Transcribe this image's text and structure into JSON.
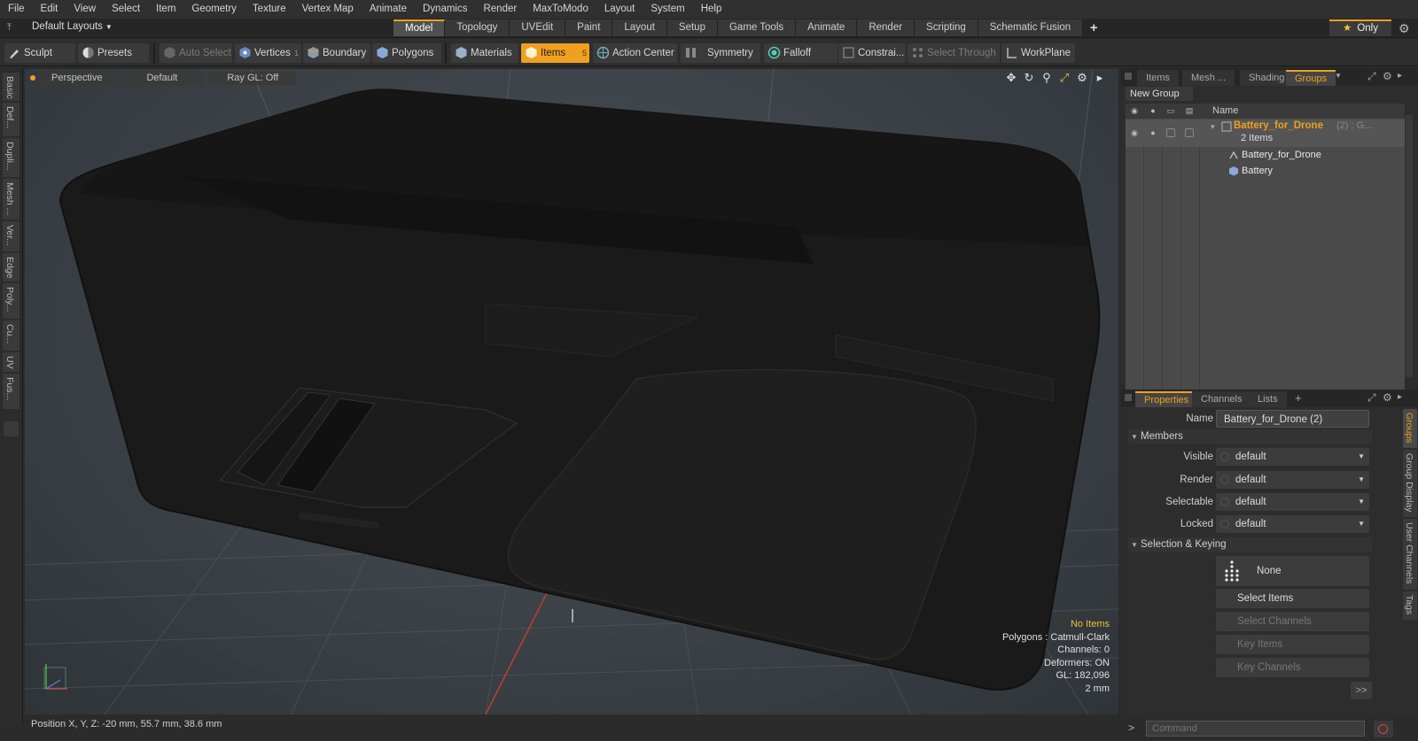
{
  "menu": [
    "File",
    "Edit",
    "View",
    "Select",
    "Item",
    "Geometry",
    "Texture",
    "Vertex Map",
    "Animate",
    "Dynamics",
    "Render",
    "MaxToModo",
    "Layout",
    "System",
    "Help"
  ],
  "layout_select": "Default Layouts",
  "tabs": [
    {
      "label": "Model",
      "active": true
    },
    {
      "label": "Topology",
      "active": false
    },
    {
      "label": "UVEdit",
      "active": false
    },
    {
      "label": "Paint",
      "active": false
    },
    {
      "label": "Layout",
      "active": false
    },
    {
      "label": "Setup",
      "active": false
    },
    {
      "label": "Game Tools",
      "active": false
    },
    {
      "label": "Animate",
      "active": false
    },
    {
      "label": "Render",
      "active": false
    },
    {
      "label": "Scripting",
      "active": false
    },
    {
      "label": "Schematic Fusion",
      "active": false
    }
  ],
  "only_label": "Only",
  "toolbar": {
    "sculpt": "Sculpt",
    "presets": "Presets",
    "auto_select": "Auto Select",
    "vertices": "Vertices",
    "vertices_count": "1",
    "boundary": "Boundary",
    "polygons": "Polygons",
    "materials": "Materials",
    "items": "Items",
    "items_count": "5",
    "action_center": "Action Center",
    "symmetry": "Symmetry",
    "falloff": "Falloff",
    "constraints": "Constrai...",
    "select_through": "Select Through",
    "workplane": "WorkPlane"
  },
  "left_tabs": [
    "Basic",
    "Def...",
    "Dupli...",
    "Mesh ...",
    "Ver...",
    "Edge",
    "Poly...",
    "Cu...",
    "UV",
    "Fus..."
  ],
  "viewport": {
    "view_mode": "Perspective",
    "shading": "Default",
    "raygl": "Ray GL: Off",
    "info": {
      "no_items": "No Items",
      "polygons": "Polygons : Catmull-Clark",
      "channels": "Channels: 0",
      "deformers": "Deformers: ON",
      "gl": "GL: 182,096",
      "scale": "2 mm"
    }
  },
  "status": "Position X, Y, Z:  -20 mm, 55.7 mm, 38.6 mm",
  "right_top": {
    "tabs": [
      {
        "label": "Items",
        "active": false
      },
      {
        "label": "Mesh ...",
        "active": false
      },
      {
        "label": "Shading",
        "active": false
      },
      {
        "label": "Groups",
        "active": true
      }
    ],
    "new_group": "New Group",
    "col_name": "Name",
    "tree": {
      "group_name": "Battery_for_Drone",
      "group_suffix": "(2) : G...",
      "group_count": "2 Items",
      "child1": "Battery_for_Drone",
      "child2": "Battery"
    }
  },
  "right_bottom": {
    "tabs": [
      {
        "label": "Properties",
        "active": true
      },
      {
        "label": "Channels",
        "active": false
      },
      {
        "label": "Lists",
        "active": false
      }
    ],
    "name_label": "Name",
    "name_value": "Battery_for_Drone (2)",
    "members_section": "Members",
    "visible_label": "Visible",
    "visible_value": "default",
    "render_label": "Render",
    "render_value": "default",
    "selectable_label": "Selectable",
    "selectable_value": "default",
    "locked_label": "Locked",
    "locked_value": "default",
    "selkey_section": "Selection & Keying",
    "none_btn": "None",
    "select_items": "Select Items",
    "select_channels": "Select Channels",
    "key_items": "Key Items",
    "key_channels": "Key Channels",
    "more": ">>",
    "vtabs": [
      "Groups",
      "Group Display",
      "User Channels",
      "Tags"
    ]
  },
  "command_placeholder": "Command",
  "colors": {
    "accent": "#f0a020",
    "highlight_text": "#f0c030"
  }
}
